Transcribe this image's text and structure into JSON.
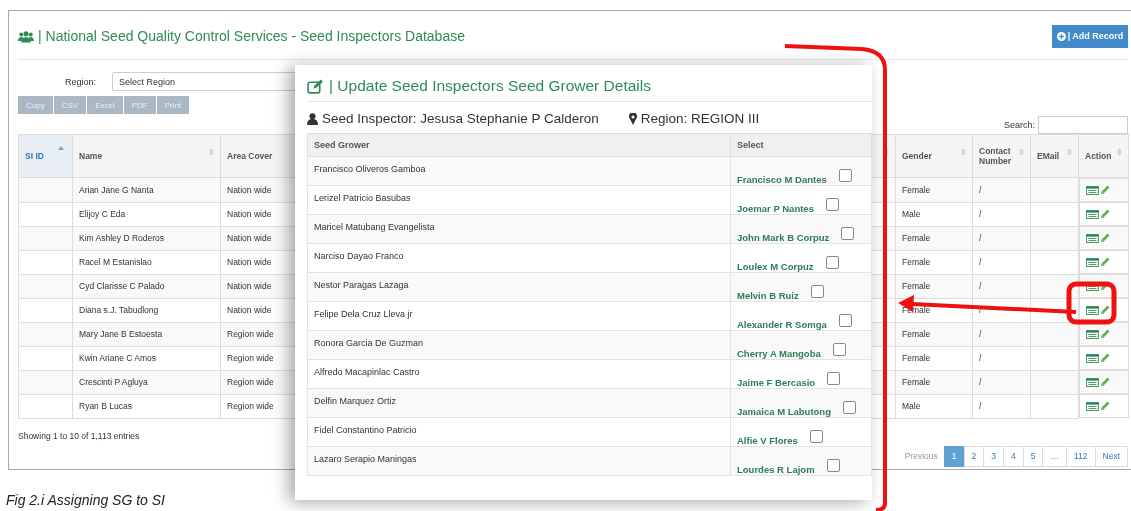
{
  "page": {
    "title": "| National Seed Quality Control Services - Seed Inspectors Database",
    "add_button": "| Add Record",
    "filter": {
      "label": "Region:",
      "value": "Select Region"
    },
    "export_buttons": [
      "Copy",
      "CSV",
      "Excel",
      "PDF",
      "Print"
    ],
    "search": {
      "label": "Search:"
    },
    "table": {
      "columns": [
        {
          "label": "SI ID",
          "sorted": true
        },
        {
          "label": "Name",
          "sorted": false
        },
        {
          "label": "Area Cover",
          "sorted": false
        },
        {
          "label": "Gender",
          "sorted": false
        },
        {
          "label": "Contact Number",
          "sorted": false
        },
        {
          "label": "EMail",
          "sorted": false
        },
        {
          "label": "Action",
          "sorted": false
        }
      ],
      "rows": [
        {
          "name": "Arian Jane G Nanta",
          "area": "Nation wide",
          "gender": "Female",
          "contact": "/"
        },
        {
          "name": "Elijoy C Eda",
          "area": "Nation wide",
          "gender": "Male",
          "contact": "/"
        },
        {
          "name": "Kim Ashley D Roderos",
          "area": "Nation wide",
          "gender": "Female",
          "contact": "/"
        },
        {
          "name": "Racel M Estanislao",
          "area": "Nation wide",
          "gender": "Female",
          "contact": "/"
        },
        {
          "name": "Cyd Clarisse C Palado",
          "area": "Nation wide",
          "gender": "Female",
          "contact": "/"
        },
        {
          "name": "Diana s.J. Tabudlong",
          "area": "Nation wide",
          "gender": "Female",
          "contact": "/"
        },
        {
          "name": "Mary Jane B Estoesta",
          "area": "Region wide",
          "gender": "Female",
          "contact": "/"
        },
        {
          "name": "Kwin Ariane C Amos",
          "area": "Region wide",
          "gender": "Female",
          "contact": "/"
        },
        {
          "name": "Crescinti P Agluya",
          "area": "Region wide",
          "gender": "Female",
          "contact": "/"
        },
        {
          "name": "Ryan B Lucas",
          "area": "Region wide",
          "gender": "Male",
          "contact": "/"
        }
      ]
    },
    "info": "Showing 1 to 10 of 1,113 entries",
    "pagination": {
      "previous": "Previous",
      "pages": [
        {
          "label": "1",
          "selected": true
        },
        {
          "label": "2",
          "selected": false
        },
        {
          "label": "3",
          "selected": false
        },
        {
          "label": "4",
          "selected": false
        },
        {
          "label": "5",
          "selected": false
        },
        {
          "label": "…",
          "selected": false
        },
        {
          "label": "112",
          "selected": false
        }
      ],
      "next": "Next"
    }
  },
  "modal": {
    "title": "| Update Seed Inspectors Seed Grower Details",
    "inspector": "Seed Inspector: Jesusa Stephanie P Calderon",
    "region": "Region: REGION III",
    "columns": [
      "Seed Grower",
      "Select"
    ],
    "rows": [
      {
        "grower": "Francisco Oliveros Gamboa",
        "select_name": "Francisco M Dantes",
        "checked": false
      },
      {
        "grower": "Lerizel Patricio Basubas",
        "select_name": "Joemar P Nantes",
        "checked": false
      },
      {
        "grower": "Maricel Matubang Evangelista",
        "select_name": "John Mark B Corpuz",
        "checked": false
      },
      {
        "grower": "Narciso Dayao Franco",
        "select_name": "Loulex M Corpuz",
        "checked": false
      },
      {
        "grower": "Nestor Paragas Lazaga",
        "select_name": "Melvin B Ruiz",
        "checked": false
      },
      {
        "grower": "Felipe Dela Cruz Lleva jr",
        "select_name": "Alexander R Somga",
        "checked": false
      },
      {
        "grower": "Ronora Garcia De Guzman",
        "select_name": "Cherry A Mangoba",
        "checked": false
      },
      {
        "grower": "Alfredo Macapinlac Castro",
        "select_name": "Jaime F Bercasio",
        "checked": false
      },
      {
        "grower": "Delfin Marquez Ortiz",
        "select_name": "Jamaica M Labutong",
        "checked": false
      },
      {
        "grower": "Fidel Constantino Patricio",
        "select_name": "Alfie V Flores",
        "checked": false
      },
      {
        "grower": "Lazaro Serapio Maningas",
        "select_name": "Lourdes R Lajom",
        "checked": false
      }
    ]
  },
  "caption": "Fig 2.i Assigning SG to SI"
}
